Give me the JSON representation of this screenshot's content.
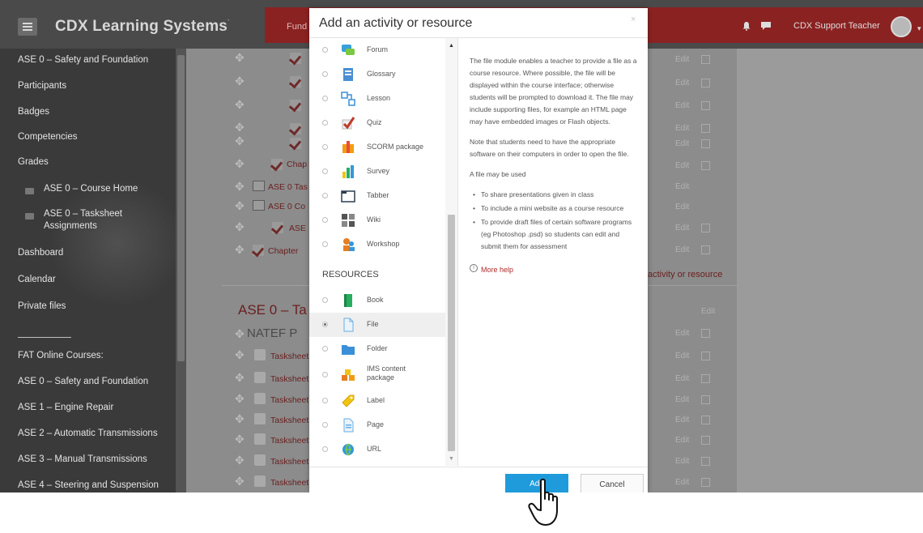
{
  "navbar": {
    "brand": "CDX Learning Systems",
    "brand_tm": "-",
    "course_short": "Fund",
    "user_name": "CDX Support Teacher"
  },
  "sidebar": {
    "items": [
      "ASE 0 – Safety and Foundation",
      "Participants",
      "Badges",
      "Competencies",
      "Grades"
    ],
    "sub_items": [
      "ASE 0 – Course Home",
      "ASE 0 – Tasksheet",
      "Assignments"
    ],
    "lower_items": [
      "Dashboard",
      "Calendar",
      "Private files"
    ],
    "courses": [
      "FAT Online Courses:",
      "ASE 0 – Safety and Foundation",
      "ASE 1 – Engine Repair",
      "ASE 2 – Automatic Transmissions",
      "ASE 3 – Manual Transmissions",
      "ASE 4 – Steering and Suspension"
    ]
  },
  "course": {
    "items_top": [
      "Chap",
      "ASE 0 Tas",
      "ASE 0 Co",
      "ASE",
      "Chapter"
    ],
    "edit_label": "Edit",
    "add_activity_link": "activity or resource",
    "section_title": "ASE 0 – Ta",
    "section_sub": "NATEF P",
    "tasksheet_label": "Tasksheet"
  },
  "modal": {
    "title": "Add an activity or resource",
    "close": "×",
    "activities": [
      {
        "label": "Forum",
        "icon": "forum-icon"
      },
      {
        "label": "Glossary",
        "icon": "glossary-icon"
      },
      {
        "label": "Lesson",
        "icon": "lesson-icon"
      },
      {
        "label": "Quiz",
        "icon": "quiz-icon"
      },
      {
        "label": "SCORM package",
        "icon": "scorm-icon"
      },
      {
        "label": "Survey",
        "icon": "survey-icon"
      },
      {
        "label": "Tabber",
        "icon": "tabber-icon"
      },
      {
        "label": "Wiki",
        "icon": "wiki-icon"
      },
      {
        "label": "Workshop",
        "icon": "workshop-icon"
      }
    ],
    "resources_header": "RESOURCES",
    "resources": [
      {
        "label": "Book",
        "icon": "book-icon"
      },
      {
        "label": "File",
        "icon": "file-icon",
        "selected": true
      },
      {
        "label": "Folder",
        "icon": "folder-icon"
      },
      {
        "label": "IMS content package",
        "label_line1": "IMS content",
        "label_line2": "package",
        "icon": "ims-icon"
      },
      {
        "label": "Label",
        "icon": "label-icon"
      },
      {
        "label": "Page",
        "icon": "page-icon"
      },
      {
        "label": "URL",
        "icon": "url-icon"
      }
    ],
    "help": {
      "p1": "The file module enables a teacher to provide a file as a course resource. Where possible, the file will be displayed within the course interface; otherwise students will be prompted to download it. The file may include supporting files, for example an HTML page may have embedded images or Flash objects.",
      "p2": "Note that students need to have the appropriate software on their computers in order to open the file.",
      "p3": "A file may be used",
      "bullets": [
        "To share presentations given in class",
        "To include a mini website as a course resource",
        "To provide draft files of certain software programs (eg Photoshop .psd) so students can edit and submit them for assessment"
      ],
      "more_help": "More help",
      "info_glyph": "i"
    },
    "add_label": "Add",
    "cancel_label": "Cancel"
  },
  "colors": {
    "accent_red": "#8b2222",
    "add_button": "#1f9bdb",
    "link_red": "#b02a2a"
  }
}
